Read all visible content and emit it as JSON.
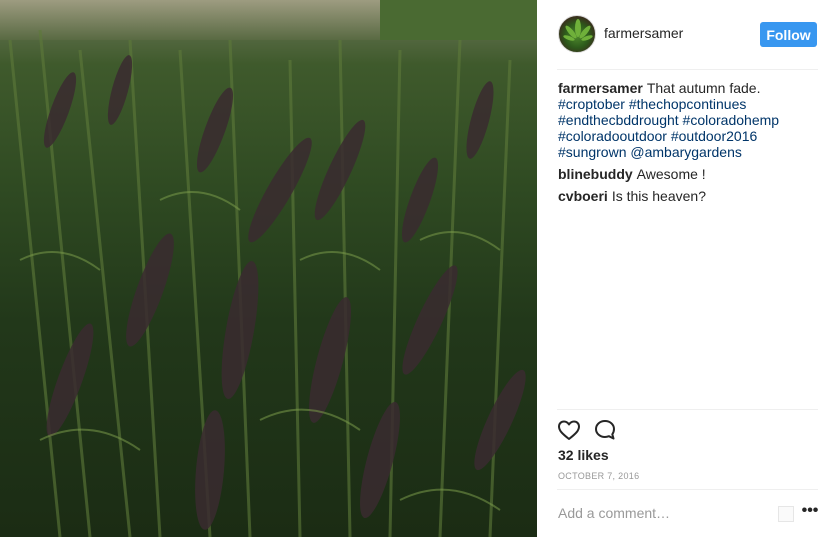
{
  "post": {
    "username": "farmersamer",
    "follow_label": "Follow",
    "image_alt_icon": "plant-photo"
  },
  "caption": {
    "user": "farmersamer",
    "text": "That autumn fade.",
    "hashtag_lines": [
      "#croptober #thechopcontinues",
      "#endthecbddrought #coloradohemp",
      "#coloradooutdoor #outdoor2016",
      "#sungrown @ambarygardens"
    ]
  },
  "comments": [
    {
      "user": "blinebuddy",
      "text": "Awesome !"
    },
    {
      "user": "cvboeri",
      "text": "Is this heaven?"
    }
  ],
  "engagement": {
    "likes": "32 likes",
    "date": "OCTOBER 7, 2016"
  },
  "composer": {
    "placeholder": "Add a comment…",
    "more_icon": "more-options-icon"
  },
  "colors": {
    "follow_button": "#3897f0",
    "hashtag": "#003569",
    "divider": "#efefef",
    "muted": "#999999"
  }
}
